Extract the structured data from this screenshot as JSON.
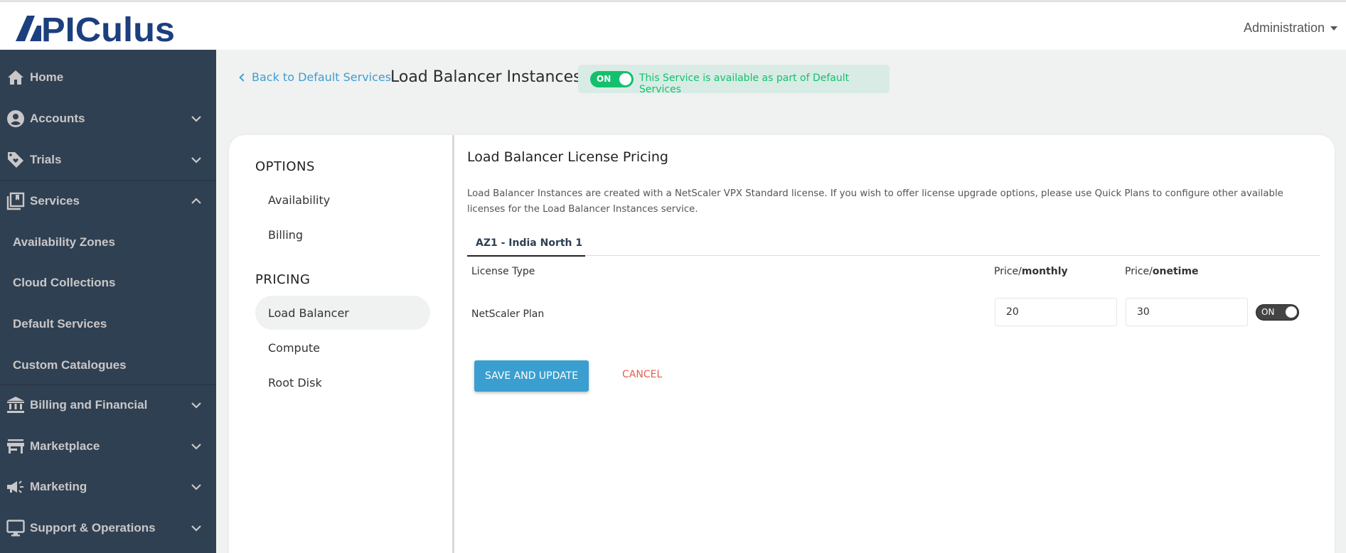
{
  "header": {
    "logo_text": "APICULUS",
    "user_menu_label": "Administration"
  },
  "sidebar": {
    "items": [
      {
        "label": "Home",
        "icon": "home-icon",
        "expandable": false
      },
      {
        "label": "Accounts",
        "icon": "account-circle-icon",
        "expandable": true,
        "expanded": false
      },
      {
        "label": "Trials",
        "icon": "tag-heart-icon",
        "expandable": true,
        "expanded": false
      },
      {
        "label": "Services",
        "icon": "library-bookmark-icon",
        "expandable": true,
        "expanded": true,
        "children": [
          "Availability Zones",
          "Cloud Collections",
          "Default Services",
          "Custom Catalogues"
        ]
      },
      {
        "label": "Billing and Financial",
        "icon": "bank-icon",
        "expandable": true,
        "expanded": false
      },
      {
        "label": "Marketplace",
        "icon": "storefront-icon",
        "expandable": true,
        "expanded": false
      },
      {
        "label": "Marketing",
        "icon": "megaphone-icon",
        "expandable": true,
        "expanded": false
      },
      {
        "label": "Support & Operations",
        "icon": "monitor-icon",
        "expandable": true,
        "expanded": false
      }
    ]
  },
  "page": {
    "back_link": "Back to Default Services",
    "title": "Load Balancer Instances",
    "availability_toggle": {
      "label": "ON",
      "state": true
    },
    "availability_message": "This Service is available as part of Default Services",
    "colors": {
      "accent_green": "#14c06e",
      "accent_blue": "#3a9fd0",
      "cancel_red": "#e35f4f",
      "sidebar_bg": "#2f4052"
    }
  },
  "options_panel": {
    "options_heading": "OPTIONS",
    "options_items": [
      "Availability",
      "Billing"
    ],
    "pricing_heading": "PRICING",
    "pricing_items": [
      "Load Balancer",
      "Compute",
      "Root Disk"
    ],
    "active_item": "Load Balancer"
  },
  "pricing": {
    "title": "Load Balancer License Pricing",
    "description": "Load Balancer Instances are created with a NetScaler VPX Standard license. If you wish to offer license upgrade options, please use Quick Plans to configure other available licenses for the Load Balancer Instances service.",
    "tabs": [
      "AZ1 - India North 1"
    ],
    "active_tab": "AZ1 - India North 1",
    "columns": {
      "license_type": "License Type",
      "monthly_prefix": "Price/",
      "monthly_bold": "monthly",
      "onetime_prefix": "Price/",
      "onetime_bold": "onetime"
    },
    "rows": [
      {
        "license_type": "NetScaler Plan",
        "price_monthly": "20",
        "price_onetime": "30",
        "toggle_label": "ON",
        "enabled": true
      }
    ],
    "save_label": "SAVE AND UPDATE",
    "cancel_label": "CANCEL"
  }
}
